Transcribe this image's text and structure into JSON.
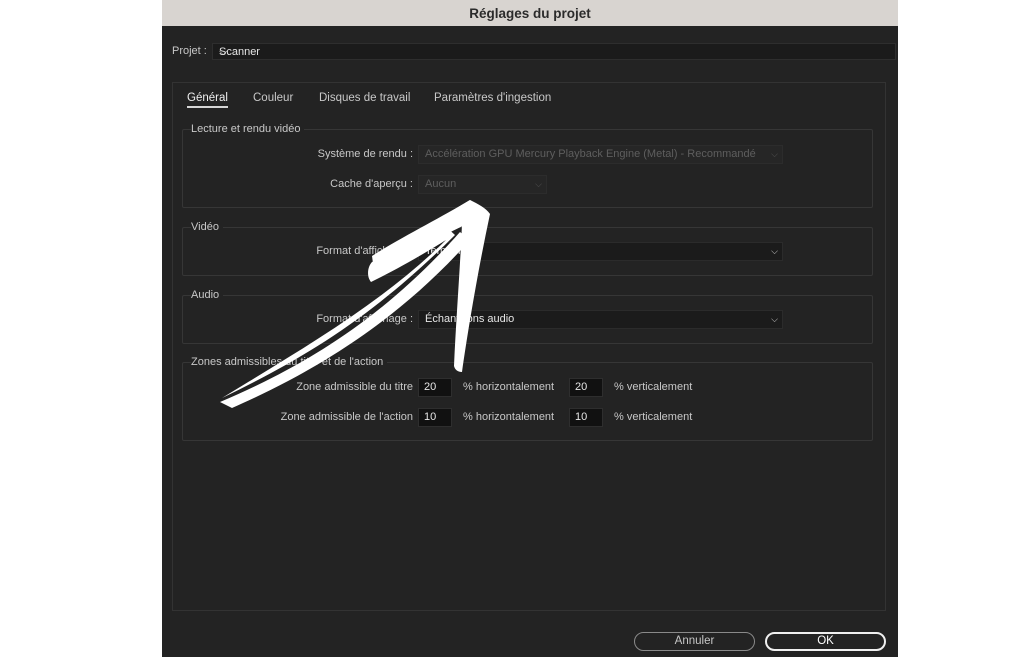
{
  "window": {
    "title": "Réglages du projet"
  },
  "project": {
    "label": "Projet :",
    "value": "Scanner"
  },
  "tabs": [
    {
      "label": "Général",
      "active": true
    },
    {
      "label": "Couleur",
      "active": false
    },
    {
      "label": "Disques de travail",
      "active": false
    },
    {
      "label": "Paramètres d'ingestion",
      "active": false
    }
  ],
  "playback": {
    "legend": "Lecture et rendu vidéo",
    "renderer_label": "Système de rendu :",
    "renderer_value": "Accélération GPU Mercury Playback Engine (Metal) - Recommandé",
    "preview_cache_label": "Cache d'aperçu :",
    "preview_cache_value": "Aucun"
  },
  "video": {
    "legend": "Vidéo",
    "format_label": "Format d'affichage :",
    "format_value": "Temporel"
  },
  "audio": {
    "legend": "Audio",
    "format_label": "Format d'affichage :",
    "format_value": "Échantillons audio"
  },
  "safe_zones": {
    "legend": "Zones admissibles du titre et de l'action",
    "title_label": "Zone admissible du titre",
    "title_h": "20",
    "title_v": "20",
    "action_label": "Zone admissible de l'action",
    "action_h": "10",
    "action_v": "10",
    "h_unit": "% horizontalement",
    "v_unit": "% verticalement"
  },
  "buttons": {
    "cancel": "Annuler",
    "ok": "OK"
  },
  "icons": {
    "dropdown": "chevron-down-icon",
    "annotation": "arrow-annotation-icon"
  },
  "colors": {
    "window_bg": "#232323",
    "titlebar_bg": "#d8d4d0",
    "annotation": "#ffffff"
  }
}
